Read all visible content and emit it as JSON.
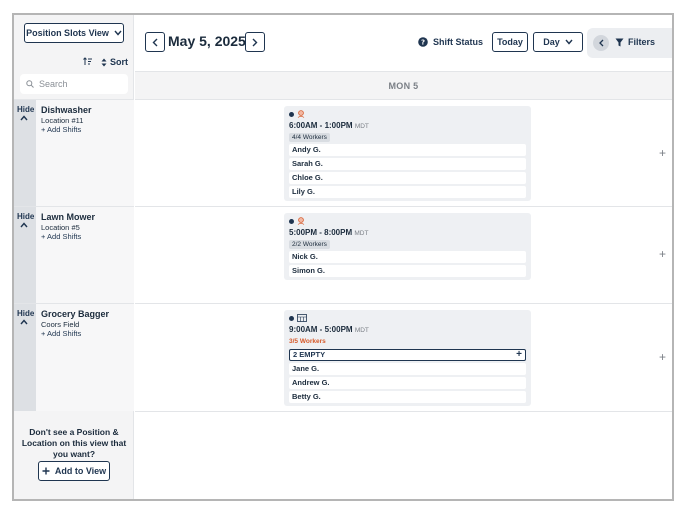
{
  "sidebar": {
    "view_select_label": "Position Slots View",
    "sort_label": "Sort",
    "search_placeholder": "Search",
    "hide_label": "Hide",
    "add_shifts_label": "+ Add Shifts",
    "positions": [
      {
        "name": "Dishwasher",
        "location": "Location #11"
      },
      {
        "name": "Lawn Mower",
        "location": "Location #5"
      },
      {
        "name": "Grocery Bagger",
        "location": "Coors Field"
      }
    ],
    "dont_see_text": "Don't see a Position & Location on this view that you want?",
    "add_to_view_label": "Add to View"
  },
  "header": {
    "date": "May 5, 2025",
    "shift_status_label": "Shift Status",
    "today_label": "Today",
    "range_label": "Day",
    "filters_label": "Filters"
  },
  "day_header": "MON 5",
  "shifts": [
    {
      "time": "6:00AM - 1:00PM",
      "tz": "MDT",
      "workers_badge": "4/4 Workers",
      "workers": [
        "Andy G.",
        "Sarah G.",
        "Chloe G.",
        "Lily G."
      ]
    },
    {
      "time": "5:00PM - 8:00PM",
      "tz": "MDT",
      "workers_badge": "2/2 Workers",
      "workers": [
        "Nick G.",
        "Simon G."
      ]
    },
    {
      "time": "9:00AM - 5:00PM",
      "tz": "MDT",
      "workers_badge": "3/5 Workers",
      "empty_label": "2 EMPTY",
      "workers": [
        "Jane G.",
        "Andrew G.",
        "Betty G."
      ]
    }
  ],
  "colors": {
    "accent": "#1f3550",
    "warning": "#d65a2b",
    "panel": "#f4f4f5"
  }
}
